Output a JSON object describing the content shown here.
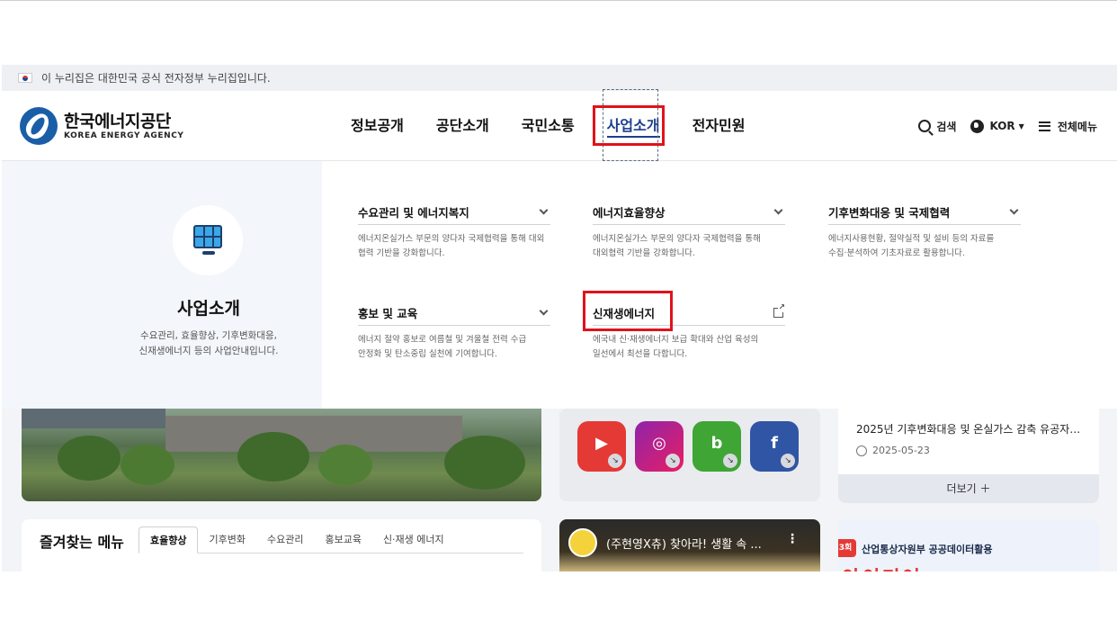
{
  "gov_banner": {
    "text": "이 누리집은 대한민국 공식 전자정부 누리집입니다."
  },
  "logo": {
    "kr": "한국에너지공단",
    "en": "KOREA ENERGY AGENCY"
  },
  "gnb": [
    {
      "label": "정보공개"
    },
    {
      "label": "공단소개"
    },
    {
      "label": "국민소통"
    },
    {
      "label": "사업소개",
      "active": true
    },
    {
      "label": "전자민원"
    }
  ],
  "utils": {
    "search": "검색",
    "lang": "KOR",
    "all_menu": "전체메뉴"
  },
  "mega": {
    "title": "사업소개",
    "desc_line1": "수요관리, 효율향상, 기후변화대응,",
    "desc_line2": "신재생에너지 등의 사업안내입니다.",
    "icon": "solar-panel-icon",
    "items": [
      {
        "title": "수요관리 및 에너지복지",
        "desc_line1": "에너지온실가스 부문의 양다자 국제협력을 통해 대외",
        "desc_line2": "협력 기반을 강화합니다.",
        "icon": "chevron-down-icon"
      },
      {
        "title": "에너지효율향상",
        "desc_line1": "에너지온실가스 부문의 양다자 국제협력을 통해",
        "desc_line2": "대외협력 기반을 강화합니다.",
        "icon": "chevron-down-icon"
      },
      {
        "title": "기후변화대응 및 국제협력",
        "desc_line1": "에너지사용현황, 절약실적 및 설비 등의 자료를",
        "desc_line2": "수집·분석하여 기초자료로 활용합니다.",
        "icon": "chevron-down-icon"
      },
      {
        "title": "홍보 및 교육",
        "desc_line1": "에너지 절약 홍보로 여름철 및 겨울철 전력 수급",
        "desc_line2": "안정화 및 탄소중립 실천에 기여합니다.",
        "icon": "chevron-down-icon"
      },
      {
        "title": "신재생에너지",
        "desc_line1": "에국내 신·재생에너지 보급 확대와 산업 육성의",
        "desc_line2": "일선에서 최선을 다합니다.",
        "icon": "external-link-icon"
      }
    ]
  },
  "notice": {
    "text": "2025년 기후변화대응 및 온실가스 감축 유공자 …",
    "date": "2025-05-23",
    "more": "더보기 ＋"
  },
  "favorites": {
    "title": "즐겨찾는 메뉴",
    "tabs": [
      {
        "label": "효율향상",
        "active": true
      },
      {
        "label": "기후변화"
      },
      {
        "label": "수요관리"
      },
      {
        "label": "홍보교육"
      },
      {
        "label": "신·재생 에너지"
      }
    ]
  },
  "video": {
    "title": "(주현영X츄) 찾아라! 생활 속 ..."
  },
  "banner": {
    "tag": "3회",
    "text": "산업통상자원부 공공데이터활용",
    "big": "아이디어"
  },
  "sns": [
    {
      "name": "youtube-icon",
      "glyph": "▶",
      "color": "#e53935"
    },
    {
      "name": "instagram-icon",
      "glyph": "◎",
      "color": "#c2185b"
    },
    {
      "name": "blog-icon",
      "glyph": "b",
      "color": "#3fa535"
    },
    {
      "name": "facebook-icon",
      "glyph": "f",
      "color": "#2f55a4"
    }
  ],
  "colors": {
    "accent": "#1c3f8c",
    "highlight": "#e0121b"
  }
}
